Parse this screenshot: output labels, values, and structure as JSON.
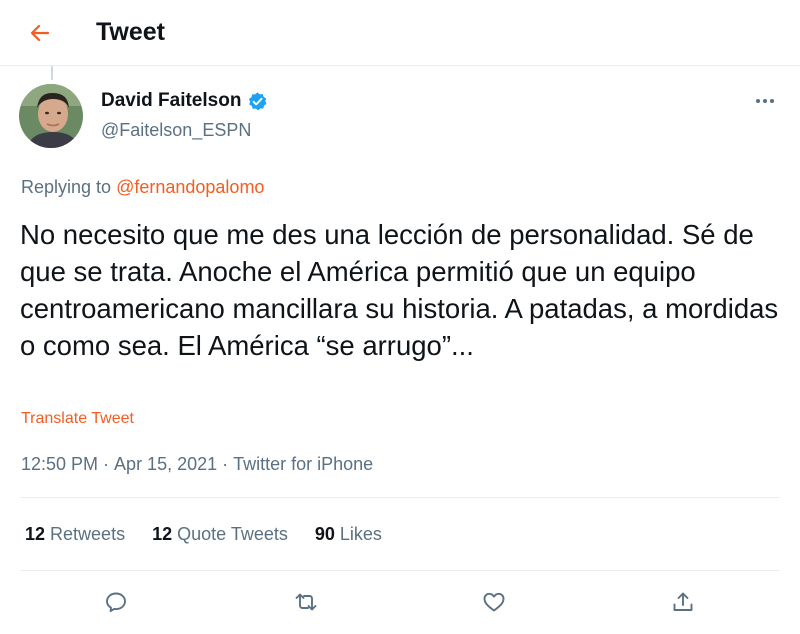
{
  "header": {
    "title": "Tweet",
    "back_icon": "arrow-left-icon",
    "accent_color": "#f45d22"
  },
  "author": {
    "display_name": "David Faitelson",
    "handle": "@Faitelson_ESPN",
    "verified": true,
    "verified_icon": "verified-badge-icon",
    "verified_color": "#1da1f2"
  },
  "more_icon": "more-horizontal-icon",
  "reply_context": {
    "prefix": "Replying to",
    "mention": "@fernandopalomo"
  },
  "tweet": {
    "text": "No necesito que me des una lección de personalidad. Sé de que se trata. Anoche el América permitió que un equipo centroamericano mancillara su historia. A patadas, a mordidas o como sea. El América “se arrugo”...",
    "translate_label": "Translate Tweet",
    "time": "12:50 PM",
    "date": "Apr 15, 2021",
    "source": "Twitter for iPhone",
    "separator": "·"
  },
  "stats": {
    "retweets": {
      "count": "12",
      "label": "Retweets"
    },
    "quote_tweets": {
      "count": "12",
      "label": "Quote Tweets"
    },
    "likes": {
      "count": "90",
      "label": "Likes"
    }
  },
  "actions": [
    "reply-icon",
    "retweet-icon",
    "like-icon",
    "share-icon"
  ],
  "colors": {
    "text_primary": "#0f1419",
    "text_secondary": "#5b7083",
    "divider": "#ebeef0"
  }
}
